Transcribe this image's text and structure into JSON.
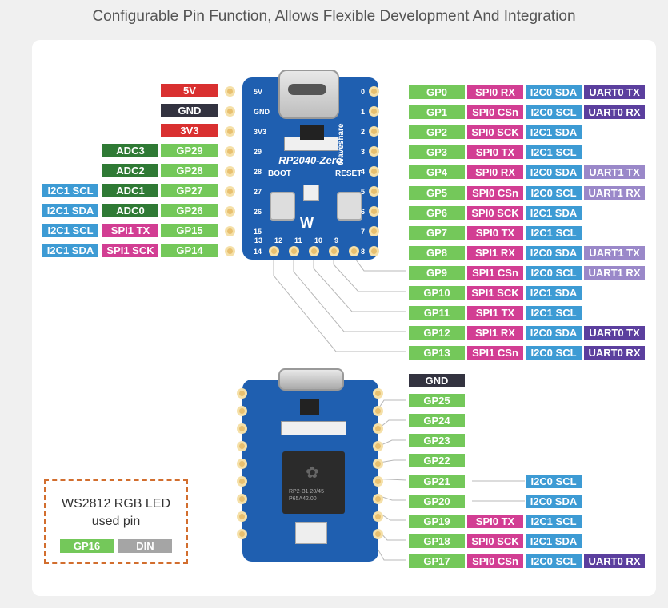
{
  "title": "Configurable Pin Function, Allows Flexible Development And Integration",
  "colors": {
    "power": "#d93030",
    "gnd": "#333340",
    "gp": "#74c85a",
    "adc": "#2f7a35",
    "spi": "#d23e93",
    "i2c": "#3d9bd4",
    "uart0": "#5b3f9e",
    "uart1": "#9a88c9",
    "din": "#a5a5a5"
  },
  "board_top": {
    "name": "RP2040-Zero",
    "brand": "Waveshare",
    "boot": "BOOT",
    "reset": "RESET",
    "silk_left": [
      "5V",
      "GND",
      "3V3",
      "29",
      "28",
      "27",
      "26",
      "15",
      "14"
    ],
    "silk_right": [
      "0",
      "1",
      "2",
      "3",
      "4",
      "5",
      "6",
      "7",
      "8"
    ],
    "silk_bottom": [
      "13",
      "12",
      "11",
      "10",
      "9"
    ]
  },
  "board_bottom": {
    "chip_text": "RP2-B1 20/45 P65A42.00"
  },
  "left_pins": [
    {
      "labels": [
        {
          "t": "5V",
          "c": "power"
        }
      ]
    },
    {
      "labels": [
        {
          "t": "GND",
          "c": "gnd"
        }
      ]
    },
    {
      "labels": [
        {
          "t": "3V3",
          "c": "power"
        }
      ]
    },
    {
      "labels": [
        {
          "t": "ADC3",
          "c": "adc"
        },
        {
          "t": "GP29",
          "c": "gp"
        }
      ]
    },
    {
      "labels": [
        {
          "t": "ADC2",
          "c": "adc"
        },
        {
          "t": "GP28",
          "c": "gp"
        }
      ]
    },
    {
      "labels": [
        {
          "t": "I2C1 SCL",
          "c": "i2c"
        },
        {
          "t": "ADC1",
          "c": "adc"
        },
        {
          "t": "GP27",
          "c": "gp"
        }
      ]
    },
    {
      "labels": [
        {
          "t": "I2C1 SDA",
          "c": "i2c"
        },
        {
          "t": "ADC0",
          "c": "adc"
        },
        {
          "t": "GP26",
          "c": "gp"
        }
      ]
    },
    {
      "labels": [
        {
          "t": "I2C1 SCL",
          "c": "i2c"
        },
        {
          "t": "SPI1 TX",
          "c": "spi"
        },
        {
          "t": "GP15",
          "c": "gp"
        }
      ]
    },
    {
      "labels": [
        {
          "t": "I2C1 SDA",
          "c": "i2c"
        },
        {
          "t": "SPI1 SCK",
          "c": "spi"
        },
        {
          "t": "GP14",
          "c": "gp"
        }
      ]
    }
  ],
  "right_pins": [
    {
      "labels": [
        {
          "t": "GP0",
          "c": "gp"
        },
        {
          "t": "SPI0 RX",
          "c": "spi"
        },
        {
          "t": "I2C0 SDA",
          "c": "i2c"
        },
        {
          "t": "UART0 TX",
          "c": "uart0"
        }
      ]
    },
    {
      "labels": [
        {
          "t": "GP1",
          "c": "gp"
        },
        {
          "t": "SPI0 CSn",
          "c": "spi"
        },
        {
          "t": "I2C0 SCL",
          "c": "i2c"
        },
        {
          "t": "UART0 RX",
          "c": "uart0"
        }
      ]
    },
    {
      "labels": [
        {
          "t": "GP2",
          "c": "gp"
        },
        {
          "t": "SPI0 SCK",
          "c": "spi"
        },
        {
          "t": "I2C1 SDA",
          "c": "i2c"
        }
      ]
    },
    {
      "labels": [
        {
          "t": "GP3",
          "c": "gp"
        },
        {
          "t": "SPI0 TX",
          "c": "spi"
        },
        {
          "t": "I2C1 SCL",
          "c": "i2c"
        }
      ]
    },
    {
      "labels": [
        {
          "t": "GP4",
          "c": "gp"
        },
        {
          "t": "SPI0 RX",
          "c": "spi"
        },
        {
          "t": "I2C0 SDA",
          "c": "i2c"
        },
        {
          "t": "UART1 TX",
          "c": "uart1"
        }
      ]
    },
    {
      "labels": [
        {
          "t": "GP5",
          "c": "gp"
        },
        {
          "t": "SPI0 CSn",
          "c": "spi"
        },
        {
          "t": "I2C0 SCL",
          "c": "i2c"
        },
        {
          "t": "UART1 RX",
          "c": "uart1"
        }
      ]
    },
    {
      "labels": [
        {
          "t": "GP6",
          "c": "gp"
        },
        {
          "t": "SPI0 SCK",
          "c": "spi"
        },
        {
          "t": "I2C1 SDA",
          "c": "i2c"
        }
      ]
    },
    {
      "labels": [
        {
          "t": "GP7",
          "c": "gp"
        },
        {
          "t": "SPI0 TX",
          "c": "spi"
        },
        {
          "t": "I2C1 SCL",
          "c": "i2c"
        }
      ]
    },
    {
      "labels": [
        {
          "t": "GP8",
          "c": "gp"
        },
        {
          "t": "SPI1 RX",
          "c": "spi"
        },
        {
          "t": "I2C0 SDA",
          "c": "i2c"
        },
        {
          "t": "UART1 TX",
          "c": "uart1"
        }
      ]
    },
    {
      "labels": [
        {
          "t": "GP9",
          "c": "gp"
        },
        {
          "t": "SPI1 CSn",
          "c": "spi"
        },
        {
          "t": "I2C0 SCL",
          "c": "i2c"
        },
        {
          "t": "UART1 RX",
          "c": "uart1"
        }
      ]
    },
    {
      "labels": [
        {
          "t": "GP10",
          "c": "gp"
        },
        {
          "t": "SPI1 SCK",
          "c": "spi"
        },
        {
          "t": "I2C1 SDA",
          "c": "i2c"
        }
      ]
    },
    {
      "labels": [
        {
          "t": "GP11",
          "c": "gp"
        },
        {
          "t": "SPI1 TX",
          "c": "spi"
        },
        {
          "t": "I2C1 SCL",
          "c": "i2c"
        }
      ]
    },
    {
      "labels": [
        {
          "t": "GP12",
          "c": "gp"
        },
        {
          "t": "SPI1 RX",
          "c": "spi"
        },
        {
          "t": "I2C0 SDA",
          "c": "i2c"
        },
        {
          "t": "UART0 TX",
          "c": "uart0"
        }
      ]
    },
    {
      "labels": [
        {
          "t": "GP13",
          "c": "gp"
        },
        {
          "t": "SPI1 CSn",
          "c": "spi"
        },
        {
          "t": "I2C0 SCL",
          "c": "i2c"
        },
        {
          "t": "UART0 RX",
          "c": "uart0"
        }
      ]
    }
  ],
  "bottom_pins": [
    {
      "labels": [
        {
          "t": "GND",
          "c": "gnd"
        }
      ]
    },
    {
      "labels": [
        {
          "t": "GP25",
          "c": "gp"
        }
      ]
    },
    {
      "labels": [
        {
          "t": "GP24",
          "c": "gp"
        }
      ]
    },
    {
      "labels": [
        {
          "t": "GP23",
          "c": "gp"
        }
      ]
    },
    {
      "labels": [
        {
          "t": "GP22",
          "c": "gp"
        }
      ]
    },
    {
      "labels": [
        {
          "t": "GP21",
          "c": "gp"
        },
        {
          "t": "",
          "c": ""
        },
        {
          "t": "I2C0 SCL",
          "c": "i2c"
        }
      ]
    },
    {
      "labels": [
        {
          "t": "GP20",
          "c": "gp"
        },
        {
          "t": "",
          "c": ""
        },
        {
          "t": "I2C0 SDA",
          "c": "i2c"
        }
      ]
    },
    {
      "labels": [
        {
          "t": "GP19",
          "c": "gp"
        },
        {
          "t": "SPI0 TX",
          "c": "spi"
        },
        {
          "t": "I2C1 SCL",
          "c": "i2c"
        }
      ]
    },
    {
      "labels": [
        {
          "t": "GP18",
          "c": "gp"
        },
        {
          "t": "SPI0 SCK",
          "c": "spi"
        },
        {
          "t": "I2C1 SDA",
          "c": "i2c"
        }
      ]
    },
    {
      "labels": [
        {
          "t": "GP17",
          "c": "gp"
        },
        {
          "t": "SPI0 CSn",
          "c": "spi"
        },
        {
          "t": "I2C0 SCL",
          "c": "i2c"
        },
        {
          "t": "UART0 RX",
          "c": "uart0"
        }
      ]
    }
  ],
  "led_box": {
    "line1": "WS2812 RGB LED",
    "line2": "used pin",
    "gp": "GP16",
    "din": "DIN"
  }
}
